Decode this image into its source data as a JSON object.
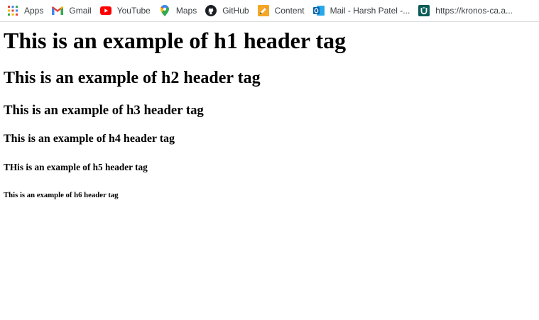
{
  "bookmarks": {
    "apps": {
      "label": "Apps",
      "icon": "apps-grid-icon"
    },
    "gmail": {
      "label": "Gmail",
      "icon": "gmail-icon"
    },
    "youtube": {
      "label": "YouTube",
      "icon": "youtube-icon"
    },
    "maps": {
      "label": "Maps",
      "icon": "maps-pin-icon"
    },
    "github": {
      "label": "GitHub",
      "icon": "github-icon"
    },
    "content": {
      "label": "Content",
      "icon": "pencil-icon"
    },
    "mail": {
      "label": "Mail - Harsh Patel -...",
      "icon": "outlook-icon"
    },
    "kronos": {
      "label": "https://kronos-ca.a...",
      "icon": "kronos-icon"
    }
  },
  "headings": {
    "h1": "This is an example of h1 header tag",
    "h2": "This is an example of h2 header tag",
    "h3": "This is an example of h3 header tag",
    "h4": "This is an example of h4 header tag",
    "h5": "THis is an example of h5 header tag",
    "h6": "This is an example of h6 header tag"
  },
  "colors": {
    "page_background": "#ffffff",
    "text": "#000000",
    "bookmark_text": "#3c4043",
    "youtube_red": "#ff0000",
    "outlook_blue": "#0a64ad",
    "kronos_teal": "#0b5d56"
  }
}
